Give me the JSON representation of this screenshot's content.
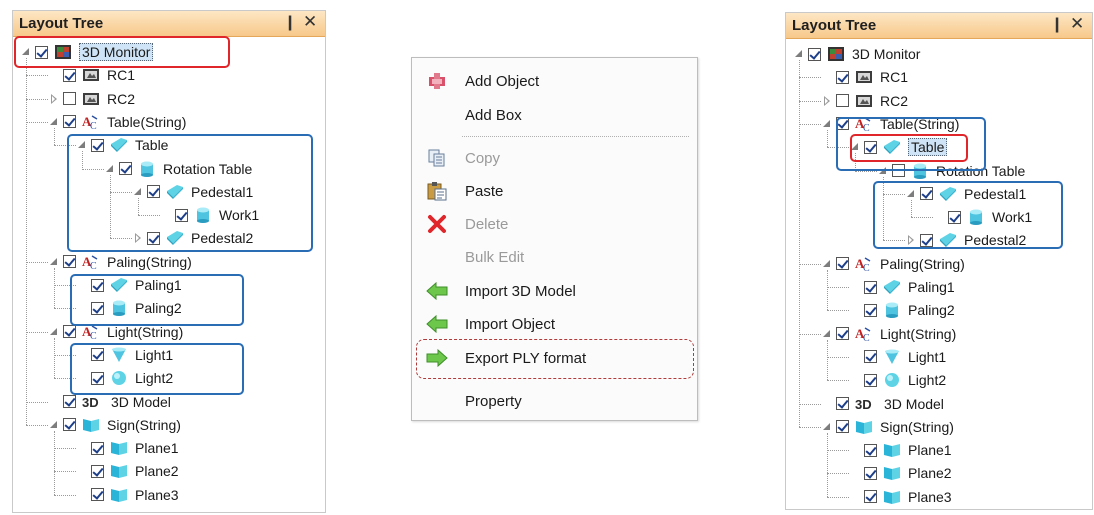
{
  "left_panel": {
    "title": "Layout Tree",
    "pin_glyph": "❙",
    "close_glyph": "✕",
    "items": [
      {
        "label": "3D Monitor",
        "checked": true,
        "icon": "monitor-icon"
      },
      {
        "label": "RC1",
        "checked": true,
        "icon": "camera-icon"
      },
      {
        "label": "RC2",
        "checked": false,
        "icon": "camera-icon"
      },
      {
        "label": "Table(String)",
        "checked": true,
        "icon": "string-text-icon"
      },
      {
        "label": "Table",
        "checked": true,
        "icon": "box-icon"
      },
      {
        "label": "Rotation Table",
        "checked": true,
        "icon": "cylinder-icon"
      },
      {
        "label": "Pedestal1",
        "checked": true,
        "icon": "box-icon"
      },
      {
        "label": "Work1",
        "checked": true,
        "icon": "cylinder-icon"
      },
      {
        "label": "Pedestal2",
        "checked": true,
        "icon": "box-icon"
      },
      {
        "label": "Paling(String)",
        "checked": true,
        "icon": "string-text-icon"
      },
      {
        "label": "Paling1",
        "checked": true,
        "icon": "box-icon"
      },
      {
        "label": "Paling2",
        "checked": true,
        "icon": "cylinder-icon"
      },
      {
        "label": "Light(String)",
        "checked": true,
        "icon": "string-text-icon"
      },
      {
        "label": "Light1",
        "checked": true,
        "icon": "cone-icon"
      },
      {
        "label": "Light2",
        "checked": true,
        "icon": "sphere-icon"
      },
      {
        "label": "3D Model",
        "checked": true,
        "icon": "3d-text-icon"
      },
      {
        "label": "Sign(String)",
        "checked": true,
        "icon": "plane-icon"
      },
      {
        "label": "Plane1",
        "checked": true,
        "icon": "plane-icon"
      },
      {
        "label": "Plane2",
        "checked": true,
        "icon": "plane-icon"
      },
      {
        "label": "Plane3",
        "checked": true,
        "icon": "plane-icon"
      }
    ]
  },
  "context_menu": {
    "items": [
      {
        "label": "Add Object",
        "enabled": true,
        "icon": "add-object-icon"
      },
      {
        "label": "Add Box",
        "enabled": true,
        "icon": ""
      },
      {
        "label": "Copy",
        "enabled": false,
        "icon": "copy-icon"
      },
      {
        "label": "Paste",
        "enabled": true,
        "icon": "paste-icon"
      },
      {
        "label": "Delete",
        "enabled": false,
        "icon": "delete-icon"
      },
      {
        "label": "Bulk Edit",
        "enabled": false,
        "icon": ""
      },
      {
        "label": "Import 3D Model",
        "enabled": true,
        "icon": "import-arrow-icon"
      },
      {
        "label": "Import Object",
        "enabled": true,
        "icon": "import-arrow-icon"
      },
      {
        "label": "Export PLY format",
        "enabled": true,
        "icon": "export-arrow-icon"
      },
      {
        "label": "Property",
        "enabled": true,
        "icon": ""
      }
    ]
  },
  "right_panel": {
    "title": "Layout Tree",
    "pin_glyph": "❙",
    "close_glyph": "✕",
    "items": [
      {
        "label": "3D Monitor",
        "checked": true,
        "icon": "monitor-icon"
      },
      {
        "label": "RC1",
        "checked": true,
        "icon": "camera-icon"
      },
      {
        "label": "RC2",
        "checked": false,
        "icon": "camera-icon"
      },
      {
        "label": "Table(String)",
        "checked": true,
        "icon": "string-text-icon"
      },
      {
        "label": "Table",
        "checked": true,
        "icon": "box-icon"
      },
      {
        "label": "Rotation Table",
        "checked": false,
        "icon": "cylinder-icon"
      },
      {
        "label": "Pedestal1",
        "checked": true,
        "icon": "box-icon"
      },
      {
        "label": "Work1",
        "checked": true,
        "icon": "cylinder-icon"
      },
      {
        "label": "Pedestal2",
        "checked": true,
        "icon": "box-icon"
      },
      {
        "label": "Paling(String)",
        "checked": true,
        "icon": "string-text-icon"
      },
      {
        "label": "Paling1",
        "checked": true,
        "icon": "box-icon"
      },
      {
        "label": "Paling2",
        "checked": true,
        "icon": "cylinder-icon"
      },
      {
        "label": "Light(String)",
        "checked": true,
        "icon": "string-text-icon"
      },
      {
        "label": "Light1",
        "checked": true,
        "icon": "cone-icon"
      },
      {
        "label": "Light2",
        "checked": true,
        "icon": "sphere-icon"
      },
      {
        "label": "3D Model",
        "checked": true,
        "icon": "3d-text-icon"
      },
      {
        "label": "Sign(String)",
        "checked": true,
        "icon": "plane-icon"
      },
      {
        "label": "Plane1",
        "checked": true,
        "icon": "plane-icon"
      },
      {
        "label": "Plane2",
        "checked": true,
        "icon": "plane-icon"
      },
      {
        "label": "Plane3",
        "checked": true,
        "icon": "plane-icon"
      }
    ]
  },
  "colors": {
    "title_bar": "#f7c88a",
    "highlight_red": "#e0262a",
    "highlight_blue": "#2a6db5",
    "selection": "#cfe4f6",
    "disabled_text": "#9a9a9a"
  }
}
